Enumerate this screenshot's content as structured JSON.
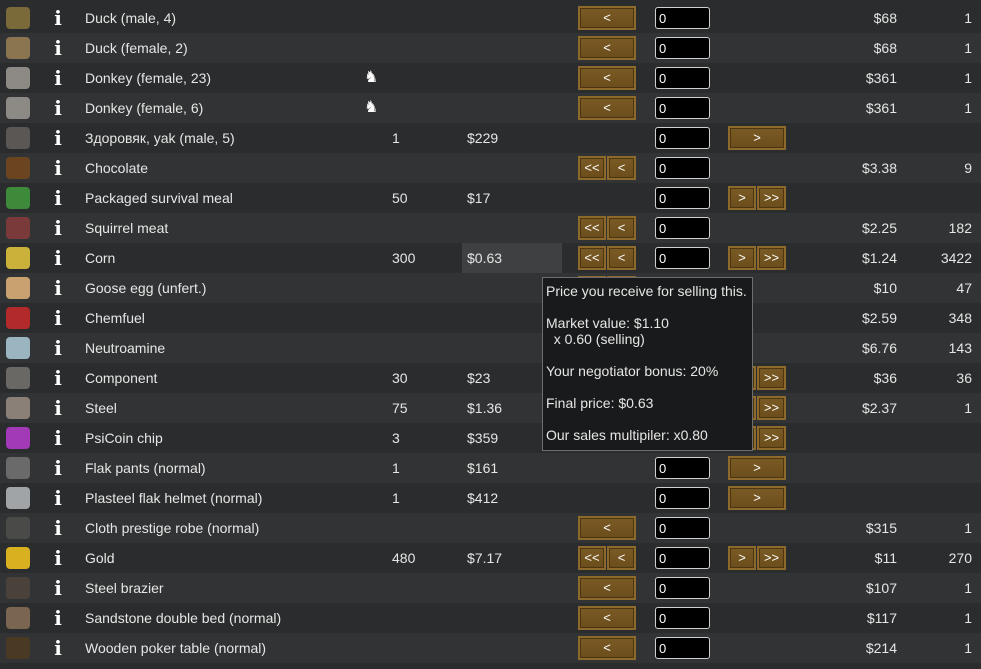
{
  "rows": [
    {
      "icon": "duck-icon",
      "name": "Duck (male, 4)",
      "our_count": "",
      "our_price": "",
      "left_buttons": "wide",
      "left_label": "<",
      "left_all_label": "",
      "qty": "0",
      "right_buttons": "none",
      "right_label": "",
      "right_all_label": "",
      "their_price": "$68",
      "their_count": "1",
      "horse": false,
      "icon_color": "#7a6a3a"
    },
    {
      "icon": "duck-icon",
      "name": "Duck (female, 2)",
      "our_count": "",
      "our_price": "",
      "left_buttons": "wide",
      "left_label": "<",
      "left_all_label": "",
      "qty": "0",
      "right_buttons": "none",
      "right_label": "",
      "right_all_label": "",
      "their_price": "$68",
      "their_count": "1",
      "horse": false,
      "icon_color": "#8a7550"
    },
    {
      "icon": "donkey-icon",
      "name": "Donkey (female, 23)",
      "our_count": "",
      "our_price": "",
      "left_buttons": "wide",
      "left_label": "<",
      "left_all_label": "",
      "qty": "0",
      "right_buttons": "none",
      "right_label": "",
      "right_all_label": "",
      "their_price": "$361",
      "their_count": "1",
      "horse": true,
      "icon_color": "#8d8a86"
    },
    {
      "icon": "donkey-icon",
      "name": "Donkey (female, 6)",
      "our_count": "",
      "our_price": "",
      "left_buttons": "wide",
      "left_label": "<",
      "left_all_label": "",
      "qty": "0",
      "right_buttons": "none",
      "right_label": "",
      "right_all_label": "",
      "their_price": "$361",
      "their_count": "1",
      "horse": true,
      "icon_color": "#8d8a86"
    },
    {
      "icon": "yak-icon",
      "name": "Здоровяк, yak (male, 5)",
      "our_count": "1",
      "our_price": "$229",
      "left_buttons": "none",
      "left_label": "",
      "left_all_label": "",
      "qty": "0",
      "right_buttons": "wide",
      "right_label": ">",
      "right_all_label": "",
      "their_price": "",
      "their_count": "",
      "horse": false,
      "icon_color": "#5a5754"
    },
    {
      "icon": "chocolate-icon",
      "name": "Chocolate",
      "our_count": "",
      "our_price": "",
      "left_buttons": "pair",
      "left_label": "<",
      "left_all_label": "<<",
      "qty": "0",
      "right_buttons": "none",
      "right_label": "",
      "right_all_label": "",
      "their_price": "$3.38",
      "their_count": "9",
      "horse": false,
      "icon_color": "#6b4420"
    },
    {
      "icon": "survival-meal-icon",
      "name": "Packaged survival meal",
      "our_count": "50",
      "our_price": "$17",
      "left_buttons": "none",
      "left_label": "",
      "left_all_label": "",
      "qty": "0",
      "right_buttons": "pair",
      "right_label": ">",
      "right_all_label": ">>",
      "their_price": "",
      "their_count": "",
      "horse": false,
      "icon_color": "#3d8a3a"
    },
    {
      "icon": "meat-icon",
      "name": "Squirrel meat",
      "our_count": "",
      "our_price": "",
      "left_buttons": "pair",
      "left_label": "<",
      "left_all_label": "<<",
      "qty": "0",
      "right_buttons": "none",
      "right_label": "",
      "right_all_label": "",
      "their_price": "$2.25",
      "their_count": "182",
      "horse": false,
      "icon_color": "#7a3a3a"
    },
    {
      "icon": "corn-icon",
      "name": "Corn",
      "our_count": "300",
      "our_price": "$0.63",
      "left_buttons": "pair",
      "left_label": "<",
      "left_all_label": "<<",
      "qty": "0",
      "right_buttons": "pair",
      "right_label": ">",
      "right_all_label": ">>",
      "their_price": "$1.24",
      "their_count": "3422",
      "horse": false,
      "icon_color": "#c9b13a",
      "highlight": true
    },
    {
      "icon": "egg-icon",
      "name": "Goose egg (unfert.)",
      "our_count": "",
      "our_price": "",
      "left_buttons": "pair",
      "left_label": "<",
      "left_all_label": "<<",
      "qty": "0",
      "right_buttons": "none",
      "right_label": "",
      "right_all_label": "",
      "their_price": "$10",
      "their_count": "47",
      "horse": false,
      "icon_color": "#c9a070"
    },
    {
      "icon": "chemfuel-icon",
      "name": "Chemfuel",
      "our_count": "",
      "our_price": "",
      "left_buttons": "pair",
      "left_label": "<",
      "left_all_label": "<<",
      "qty": "0",
      "right_buttons": "none",
      "right_label": "",
      "right_all_label": "",
      "their_price": "$2.59",
      "their_count": "348",
      "horse": false,
      "icon_color": "#b22a2a"
    },
    {
      "icon": "medicine-icon",
      "name": "Neutroamine",
      "our_count": "",
      "our_price": "",
      "left_buttons": "pair",
      "left_label": "<",
      "left_all_label": "<<",
      "qty": "0",
      "right_buttons": "none",
      "right_label": "",
      "right_all_label": "",
      "their_price": "$6.76",
      "their_count": "143",
      "horse": false,
      "icon_color": "#9ab4c0"
    },
    {
      "icon": "component-icon",
      "name": "Component",
      "our_count": "30",
      "our_price": "$23",
      "left_buttons": "pair",
      "left_label": "<",
      "left_all_label": "<<",
      "qty": "0",
      "right_buttons": "pair",
      "right_label": ">",
      "right_all_label": ">>",
      "their_price": "$36",
      "their_count": "36",
      "horse": false,
      "icon_color": "#6a6864"
    },
    {
      "icon": "steel-icon",
      "name": "Steel",
      "our_count": "75",
      "our_price": "$1.36",
      "left_buttons": "pair",
      "left_label": "<",
      "left_all_label": "<<",
      "qty": "0",
      "right_buttons": "pair",
      "right_label": ">",
      "right_all_label": ">>",
      "their_price": "$2.37",
      "their_count": "1",
      "horse": false,
      "icon_color": "#8a8078"
    },
    {
      "icon": "psicoin-icon",
      "name": "PsiCoin chip",
      "our_count": "3",
      "our_price": "$359",
      "left_buttons": "none",
      "left_label": "",
      "left_all_label": "",
      "qty": "0",
      "right_buttons": "pair",
      "right_label": ">",
      "right_all_label": ">>",
      "their_price": "",
      "their_count": "",
      "horse": false,
      "icon_color": "#a23ab8"
    },
    {
      "icon": "pants-icon",
      "name": "Flak pants (normal)",
      "our_count": "1",
      "our_price": "$161",
      "left_buttons": "none",
      "left_label": "",
      "left_all_label": "",
      "qty": "0",
      "right_buttons": "wide",
      "right_label": ">",
      "right_all_label": "",
      "their_price": "",
      "their_count": "",
      "horse": false,
      "icon_color": "#6a6a6a"
    },
    {
      "icon": "helmet-icon",
      "name": "Plasteel flak helmet (normal)",
      "our_count": "1",
      "our_price": "$412",
      "left_buttons": "none",
      "left_label": "",
      "left_all_label": "",
      "qty": "0",
      "right_buttons": "wide",
      "right_label": ">",
      "right_all_label": "",
      "their_price": "",
      "their_count": "",
      "horse": false,
      "icon_color": "#a0a4a6"
    },
    {
      "icon": "robe-icon",
      "name": "Cloth prestige robe (normal)",
      "our_count": "",
      "our_price": "",
      "left_buttons": "wide",
      "left_label": "<",
      "left_all_label": "",
      "qty": "0",
      "right_buttons": "none",
      "right_label": "",
      "right_all_label": "",
      "their_price": "$315",
      "their_count": "1",
      "horse": false,
      "icon_color": "#4a4a48"
    },
    {
      "icon": "gold-icon",
      "name": "Gold",
      "our_count": "480",
      "our_price": "$7.17",
      "left_buttons": "pair",
      "left_label": "<",
      "left_all_label": "<<",
      "qty": "0",
      "right_buttons": "pair",
      "right_label": ">",
      "right_all_label": ">>",
      "their_price": "$11",
      "their_count": "270",
      "horse": false,
      "icon_color": "#d8b020"
    },
    {
      "icon": "brazier-icon",
      "name": "Steel brazier",
      "our_count": "",
      "our_price": "",
      "left_buttons": "wide",
      "left_label": "<",
      "left_all_label": "",
      "qty": "0",
      "right_buttons": "none",
      "right_label": "",
      "right_all_label": "",
      "their_price": "$107",
      "their_count": "1",
      "horse": false,
      "icon_color": "#4a423a"
    },
    {
      "icon": "bed-icon",
      "name": "Sandstone double bed (normal)",
      "our_count": "",
      "our_price": "",
      "left_buttons": "wide",
      "left_label": "<",
      "left_all_label": "",
      "qty": "0",
      "right_buttons": "none",
      "right_label": "",
      "right_all_label": "",
      "their_price": "$117",
      "their_count": "1",
      "horse": false,
      "icon_color": "#7a6650"
    },
    {
      "icon": "table-icon",
      "name": "Wooden poker table (normal)",
      "our_count": "",
      "our_price": "",
      "left_buttons": "wide",
      "left_label": "<",
      "left_all_label": "",
      "qty": "0",
      "right_buttons": "none",
      "right_label": "",
      "right_all_label": "",
      "their_price": "$214",
      "their_count": "1",
      "horse": false,
      "icon_color": "#4a3a24"
    }
  ],
  "tooltip": {
    "line1": "Price you receive for selling this.",
    "line2": "Market value: $1.10",
    "line3": "  x 0.60 (selling)",
    "line4": "Your negotiator bonus: 20%",
    "line5": "Final price: $0.63",
    "line6": "Our sales multipiler: x0.80"
  }
}
